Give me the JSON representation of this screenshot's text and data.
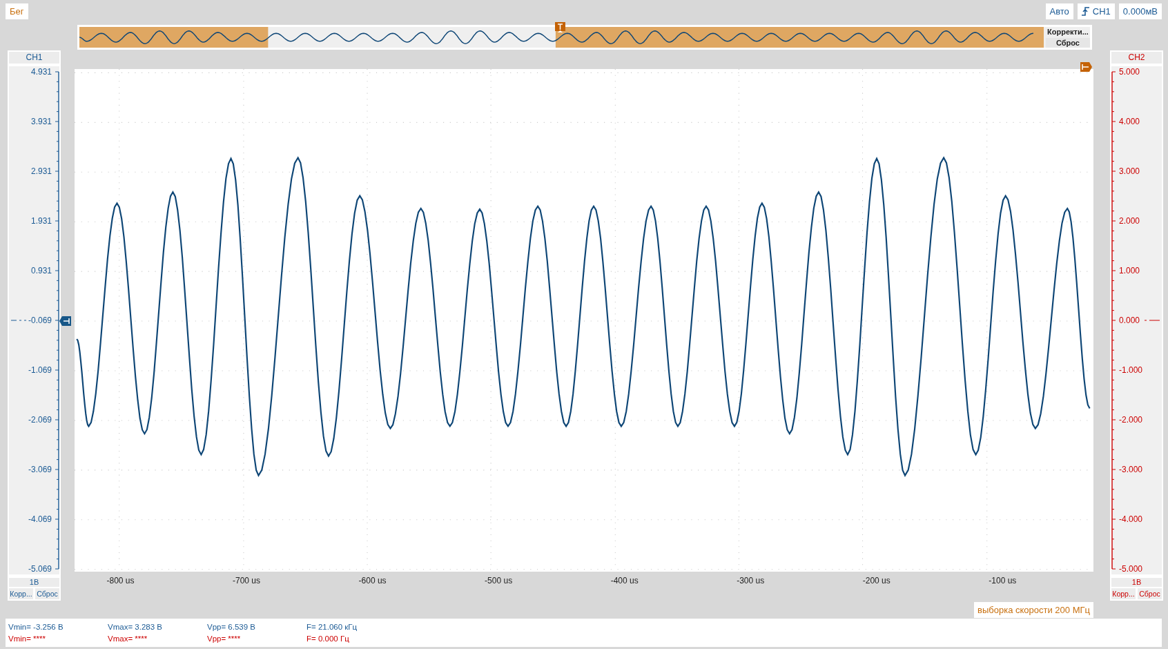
{
  "run_button": "Бег",
  "trigger": {
    "mode": "Авто",
    "source": "CH1",
    "level": "0.000мВ"
  },
  "overview": {
    "buttons": [
      "Корректи...",
      "Сброс"
    ]
  },
  "channels": [
    {
      "name": "CH1",
      "color": "#1b5a94",
      "scale": "1В",
      "buttons": [
        "Корр...",
        "Сброс"
      ],
      "ticks": [
        {
          "label": "4.931",
          "reference": false
        },
        {
          "label": "3.931",
          "reference": false
        },
        {
          "label": "2.931",
          "reference": false
        },
        {
          "label": "1.931",
          "reference": false
        },
        {
          "label": "0.931",
          "reference": false
        },
        {
          "label": "-0.069",
          "reference": true
        },
        {
          "label": "-1.069",
          "reference": false
        },
        {
          "label": "-2.069",
          "reference": false
        },
        {
          "label": "-3.069",
          "reference": false
        },
        {
          "label": "-4.069",
          "reference": false
        },
        {
          "label": "-5.069",
          "reference": false
        }
      ]
    },
    {
      "name": "CH2",
      "color": "#cc0000",
      "scale": "1В",
      "buttons": [
        "Корр...",
        "Сброс"
      ],
      "ticks": [
        {
          "label": "5.000",
          "reference": false
        },
        {
          "label": "4.000",
          "reference": false
        },
        {
          "label": "3.000",
          "reference": false
        },
        {
          "label": "2.000",
          "reference": false
        },
        {
          "label": "1.000",
          "reference": false
        },
        {
          "label": "0.000",
          "reference": true
        },
        {
          "label": "-1.000",
          "reference": false
        },
        {
          "label": "-2.000",
          "reference": false
        },
        {
          "label": "-3.000",
          "reference": false
        },
        {
          "label": "-4.000",
          "reference": false
        },
        {
          "label": "-5.000",
          "reference": false
        }
      ]
    }
  ],
  "x_axis": [
    "-800 us",
    "-700 us",
    "-600 us",
    "-500 us",
    "-400 us",
    "-300 us",
    "-200 us",
    "-100 us"
  ],
  "sample_rate": "выборка скорости 200 МГц",
  "measurements": [
    {
      "items": [
        "Vmin= -3.256 В",
        "Vmax= 3.283 В",
        "Vpp= 6.539 В",
        "F= 21.060 кГц"
      ]
    },
    {
      "items": [
        "Vmin= ****",
        "Vmax= ****",
        "Vpp= ****",
        "F= 0.000 Гц"
      ]
    }
  ]
}
